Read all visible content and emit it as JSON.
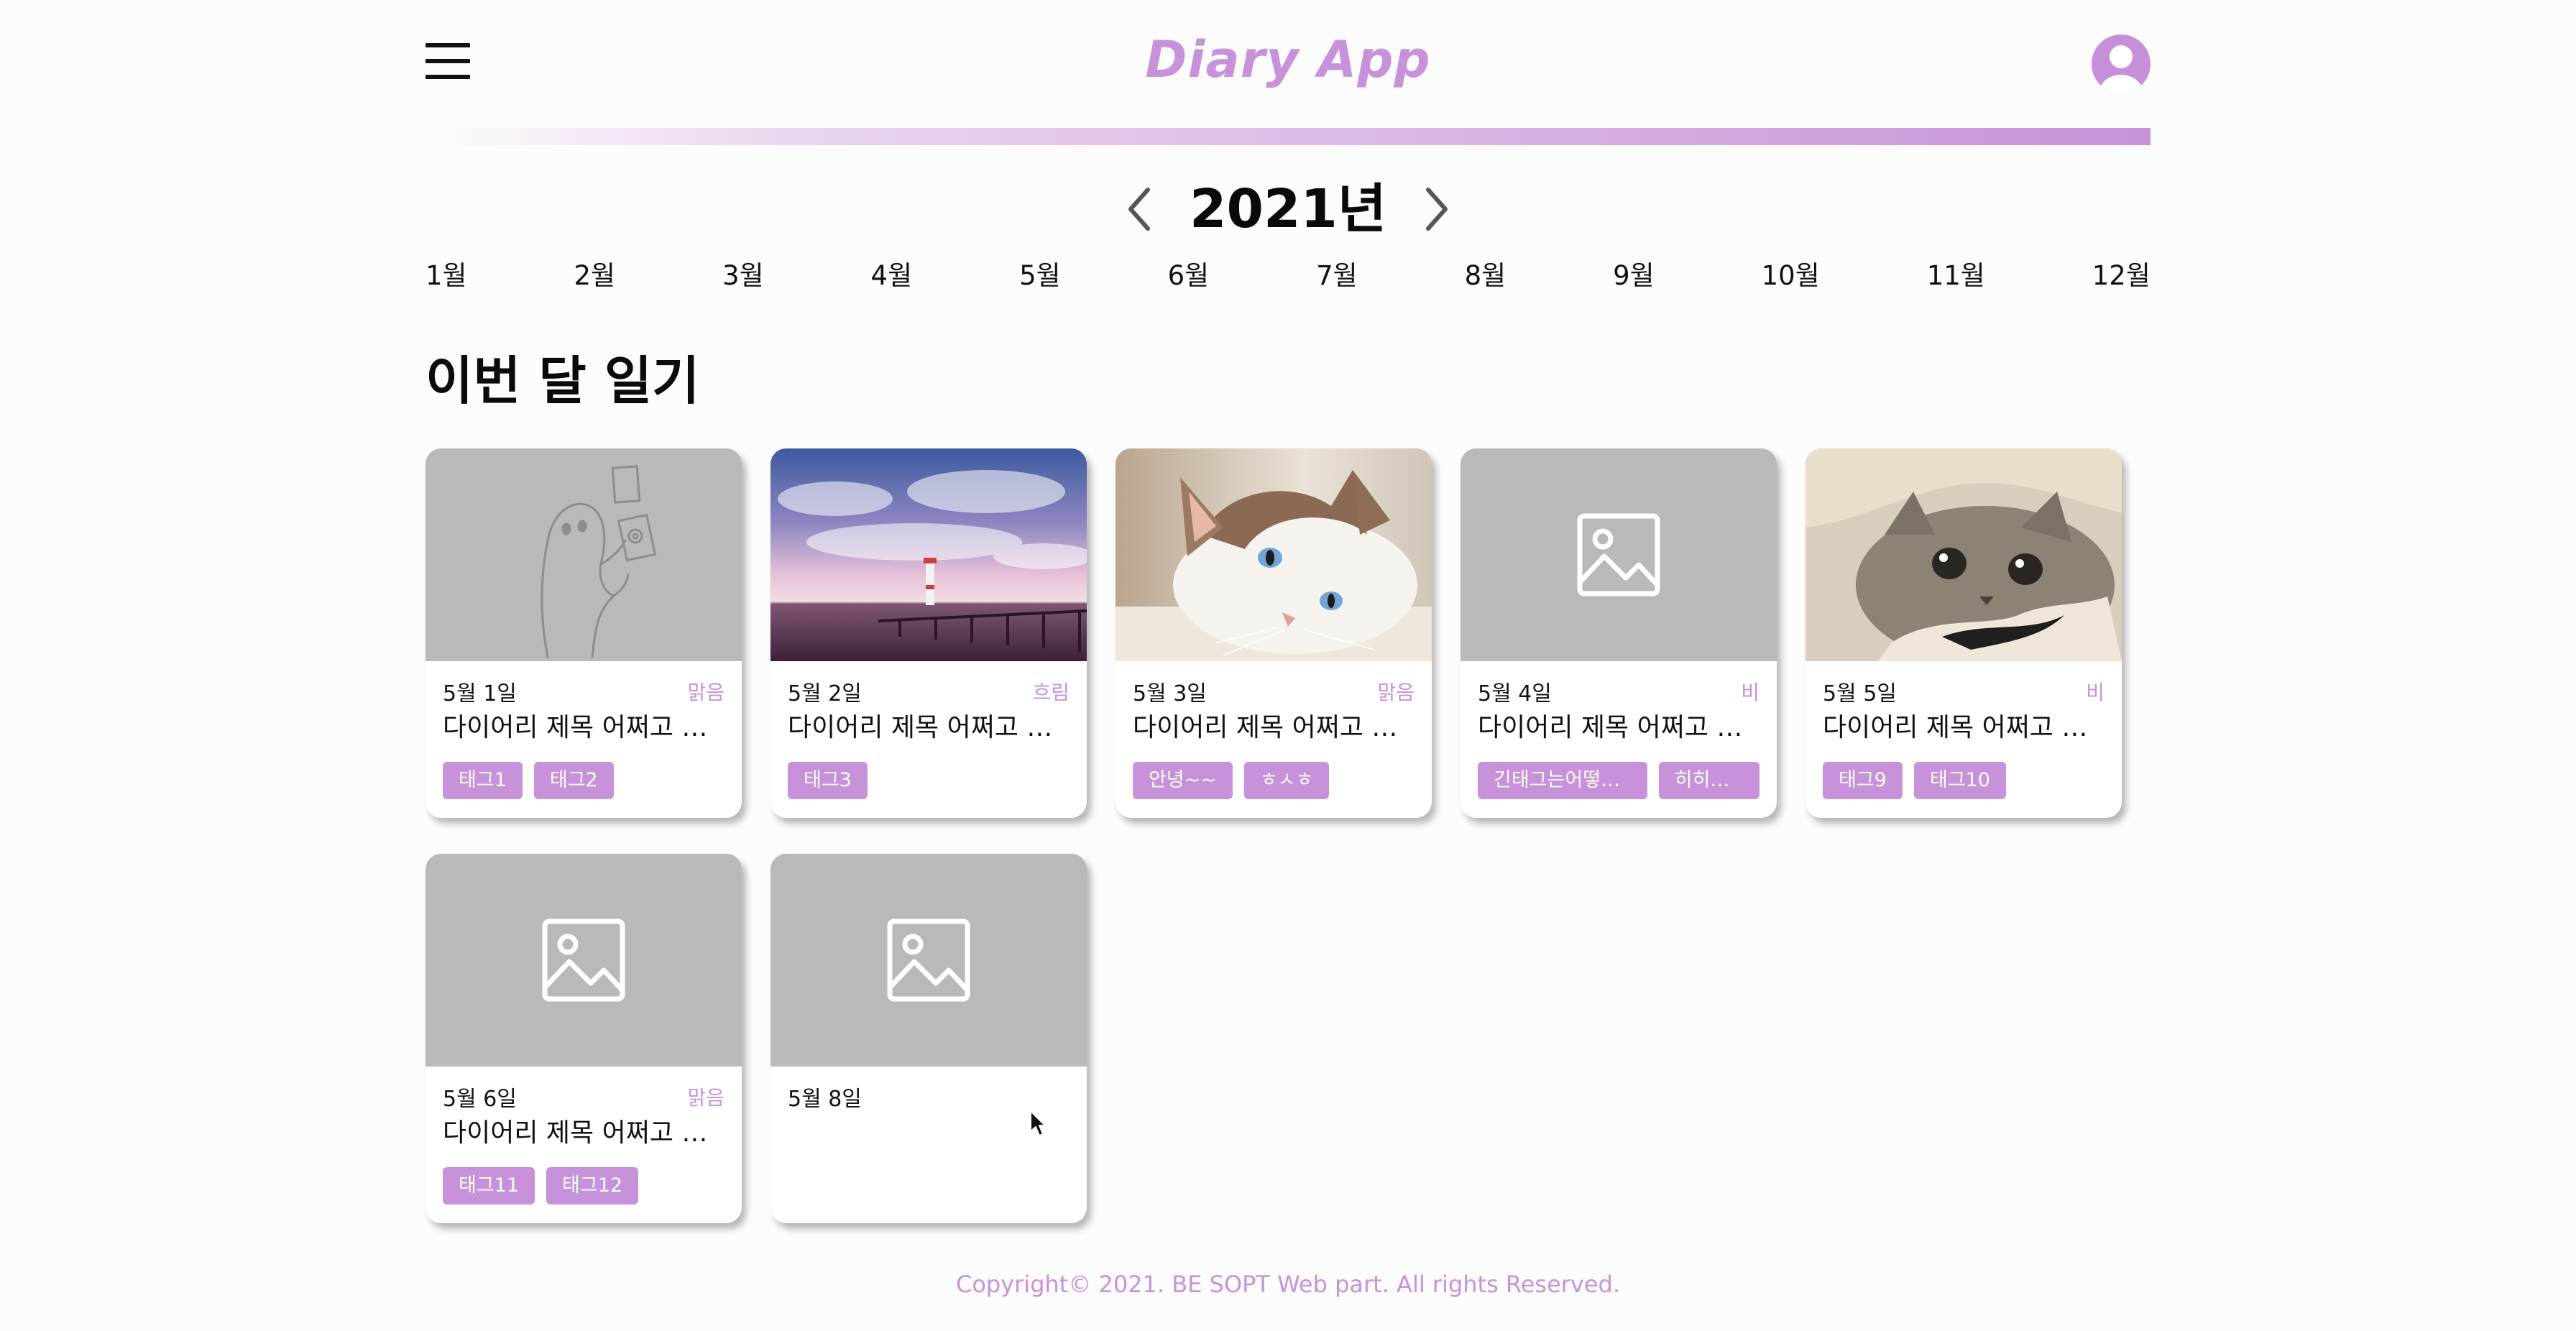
{
  "header": {
    "title": "Diary App",
    "menu_icon": "hamburger-menu-icon",
    "avatar_icon": "user-avatar-icon",
    "accent_color": "#c792d9"
  },
  "year_nav": {
    "year_label": "2021년",
    "prev_icon": "chevron-left-icon",
    "next_icon": "chevron-right-icon"
  },
  "months": [
    "1월",
    "2월",
    "3월",
    "4월",
    "5월",
    "6월",
    "7월",
    "8월",
    "9월",
    "10월",
    "11월",
    "12월"
  ],
  "section": {
    "title": "이번 달 일기"
  },
  "cards": [
    {
      "image": "ghost-sketch-illustration",
      "date": "5월 1일",
      "weather": "맑음",
      "title": "다이어리 제목 어쩌고 저쩌고",
      "tags": [
        "태그1",
        "태그2"
      ]
    },
    {
      "image": "lighthouse-sunset-photo",
      "date": "5월 2일",
      "weather": "흐림",
      "title": "다이어리 제목 어쩌고 저쩌고",
      "tags": [
        "태그3"
      ]
    },
    {
      "image": "white-cat-photo",
      "date": "5월 3일",
      "weather": "맑음",
      "title": "다이어리 제목 어쩌고 저쩌고",
      "tags": [
        "안녕~~",
        "ㅎㅅㅎ"
      ]
    },
    {
      "image": "image-placeholder-icon",
      "date": "5월 4일",
      "weather": "비",
      "title": "다이어리 제목 어쩌고 저쩌고",
      "tags": [
        "긴태그는어떻게...",
        "히히히..."
      ]
    },
    {
      "image": "gray-cat-blanket-photo",
      "date": "5월 5일",
      "weather": "비",
      "title": "다이어리 제목 어쩌고 저쩌고",
      "tags": [
        "태그9",
        "태그10"
      ]
    },
    {
      "image": "image-placeholder-icon",
      "date": "5월 6일",
      "weather": "맑음",
      "title": "다이어리 제목 어쩌고 저쩌고",
      "tags": [
        "태그11",
        "태그12"
      ]
    },
    {
      "image": "image-placeholder-icon",
      "date": "5월 8일",
      "weather": "",
      "title": "",
      "tags": []
    }
  ],
  "footer": {
    "copyright": "Copyright© 2021. BE SOPT Web part. All rights Reserved."
  }
}
